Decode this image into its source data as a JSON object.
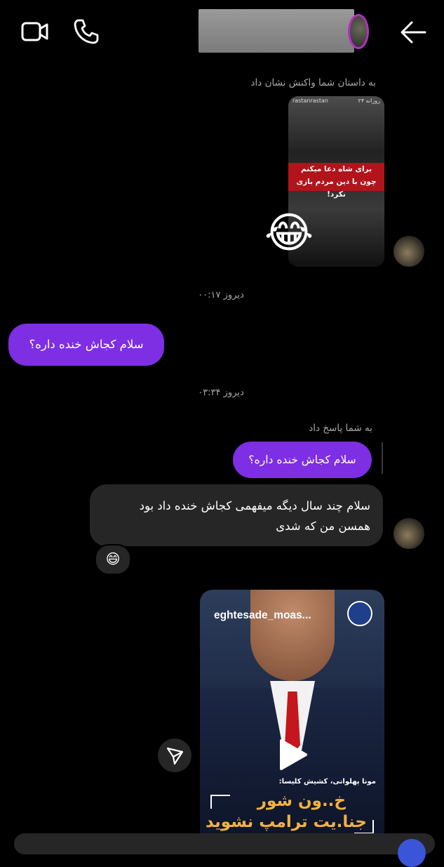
{
  "header": {
    "back_icon": "arrow-left-icon",
    "phone_icon": "phone-icon",
    "video_icon": "video-camera-icon"
  },
  "messages": {
    "story_reaction_label": "به داستان شما واکنش نشان داد",
    "story": {
      "banner_line1": "برای شاه دعا میکنم",
      "banner_line2": "چون با دین مردم بازی نکرد!",
      "tag_left": "rastanrastan",
      "tag_right": "روزانه ۲۴",
      "reaction_emoji": "😂"
    },
    "time1": "دیروز ۰۰:۱۷",
    "sent1": "سلام کجاش خنده داره؟",
    "time2": "دیروز ۰۳:۳۴",
    "reply_label": "به شما پاسخ داد",
    "quoted": "سلام کجاش خنده داره؟",
    "received_line1": "سلام چند سال دیگه میفهمی کجاش خنده داد بود",
    "received_line2": "همسن من که شدی",
    "received_reaction": "😄",
    "reel": {
      "username": "eghtesade_moas...",
      "caption": "مونا پهلوانی، کشیش کلیسا:",
      "headline1": "خ..ون شور",
      "headline2": "جنا.یت ترامپ نشوید"
    }
  },
  "colors": {
    "sent_bubble": "#7e2ee3",
    "received_bubble": "#262626",
    "background": "#000000"
  }
}
